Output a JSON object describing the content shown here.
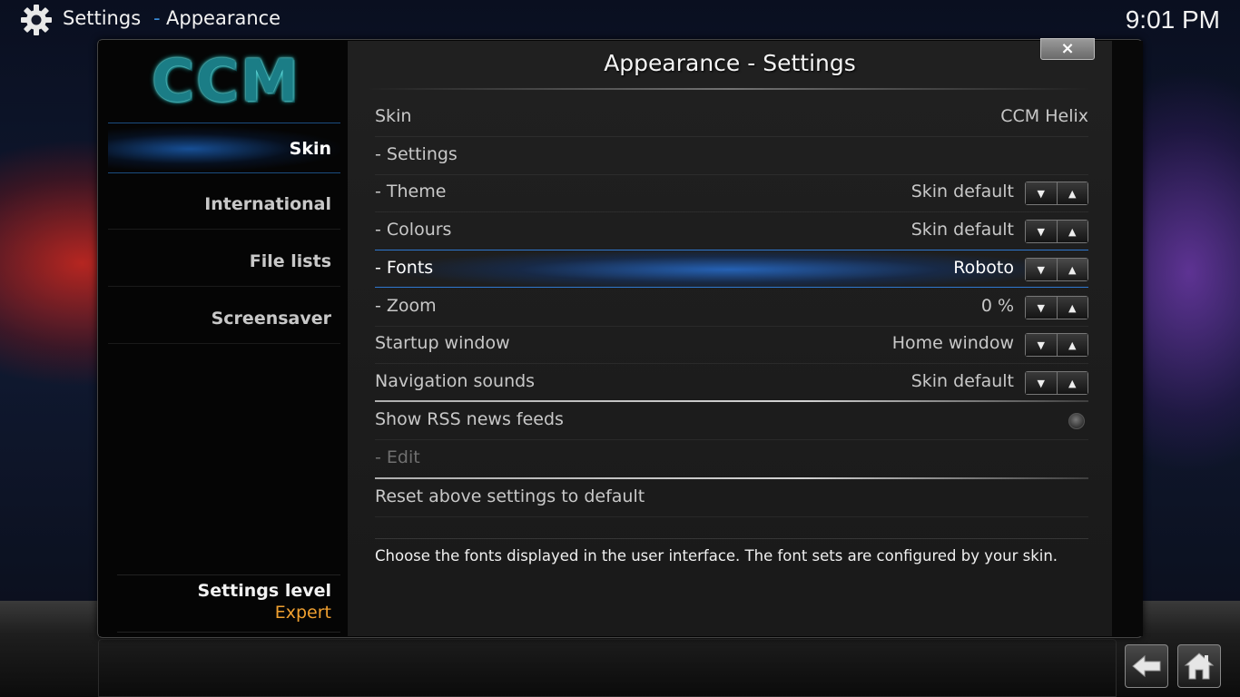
{
  "header": {
    "section": "Settings",
    "separator": "-",
    "subsection": "Appearance",
    "clock": "9:01 PM"
  },
  "dialog": {
    "title": "Appearance - Settings",
    "close_label": "×"
  },
  "sidebar": {
    "logo": "CCM",
    "items": [
      {
        "label": "Skin"
      },
      {
        "label": "International"
      },
      {
        "label": "File lists"
      },
      {
        "label": "Screensaver"
      }
    ],
    "settings_level_label": "Settings level",
    "settings_level_value": "Expert"
  },
  "settings": {
    "rows": [
      {
        "label": "Skin",
        "value": "CCM Helix"
      },
      {
        "label": "- Settings",
        "value": ""
      },
      {
        "label": "- Theme",
        "value": "Skin default"
      },
      {
        "label": "- Colours",
        "value": "Skin default"
      },
      {
        "label": "- Fonts",
        "value": "Roboto"
      },
      {
        "label": "- Zoom",
        "value": "0 %"
      },
      {
        "label": "Startup window",
        "value": "Home window"
      },
      {
        "label": "Navigation sounds",
        "value": "Skin default"
      },
      {
        "label": "Show RSS news feeds",
        "value": ""
      },
      {
        "label": "- Edit",
        "value": ""
      },
      {
        "label": "Reset above settings to default",
        "value": ""
      }
    ],
    "description": "Choose the fonts displayed in the user interface. The font sets are configured by your skin.",
    "rss_enabled": false,
    "focused_row": "- Fonts"
  },
  "icons": {
    "header": "gear-icon",
    "back": "back-arrow-icon",
    "home": "home-icon",
    "spin_down": "arrow-down-icon",
    "spin_up": "arrow-up-icon"
  },
  "colors": {
    "accent_blue": "#3a8cd8",
    "level_orange": "#f0a030"
  }
}
